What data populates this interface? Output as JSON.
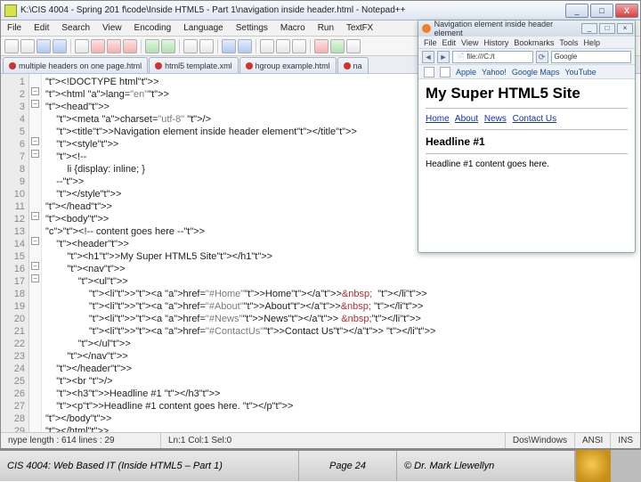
{
  "npp": {
    "title": "K:\\CIS 4004 - Spring 201 f\\code\\Inside HTML5 - Part 1\\navigation inside header.html - Notepad++",
    "menu": [
      "File",
      "Edit",
      "Search",
      "View",
      "Encoding",
      "Language",
      "Settings",
      "Macro",
      "Run",
      "TextFX"
    ],
    "tabs": [
      "multiple headers on one page.html",
      "html5 template.xml",
      "hgroup example.html",
      "na"
    ],
    "status": {
      "len": "nype length : 614   lines : 29",
      "pos": "Ln:1   Col:1   Sel:0",
      "eol": "Dos\\Windows",
      "enc": "ANSI",
      "mode": "INS"
    },
    "lines": [
      "<!DOCTYPE html>",
      "<html lang=\"en\">",
      "<head>",
      "    <meta charset=\"utf-8\" />",
      "    <title>Navigation element inside header element</title>",
      "    <style>",
      "    <!--",
      "        li {display: inline; }",
      "    -->",
      "    </style>",
      "</head>",
      "<body>",
      "<!-- content goes here -->",
      "    <header>",
      "        <h1>My Super HTML5 Site</h1>",
      "        <nav>",
      "            <ul>",
      "                <li><a href=\"#Home\">Home</a>&nbsp;  </li>",
      "                <li><a href=\"#About\">About</a>&nbsp; </li>",
      "                <li><a href=\"#News\">News</a> &nbsp;</li>",
      "                <li><a href=\"#ContactUs\">Contact Us</a> </li>",
      "            </ul>",
      "        </nav>",
      "    </header>",
      "    <br />",
      "    <h3>Headline #1 </h3>",
      "    <p>Headline #1 content goes here. </p>",
      "</body>",
      "</html>"
    ]
  },
  "browser": {
    "title": "Navigation element inside header element",
    "menu": [
      "File",
      "Edit",
      "View",
      "History",
      "Bookmarks",
      "Tools",
      "Help"
    ],
    "url": "file:///C:/t",
    "search_ph": "Google",
    "bookmarks": [
      "Apple",
      "Yahoo!",
      "Google Maps",
      "YouTube"
    ],
    "h1": "My Super HTML5 Site",
    "nav": [
      "Home",
      "About",
      "News",
      "Contact Us"
    ],
    "h3": "Headline #1",
    "p": "Headline #1 content goes here."
  },
  "footer": {
    "left": "CIS 4004: Web Based IT (Inside HTML5 – Part 1)",
    "mid": "Page 24",
    "right": "© Dr. Mark Llewellyn"
  }
}
